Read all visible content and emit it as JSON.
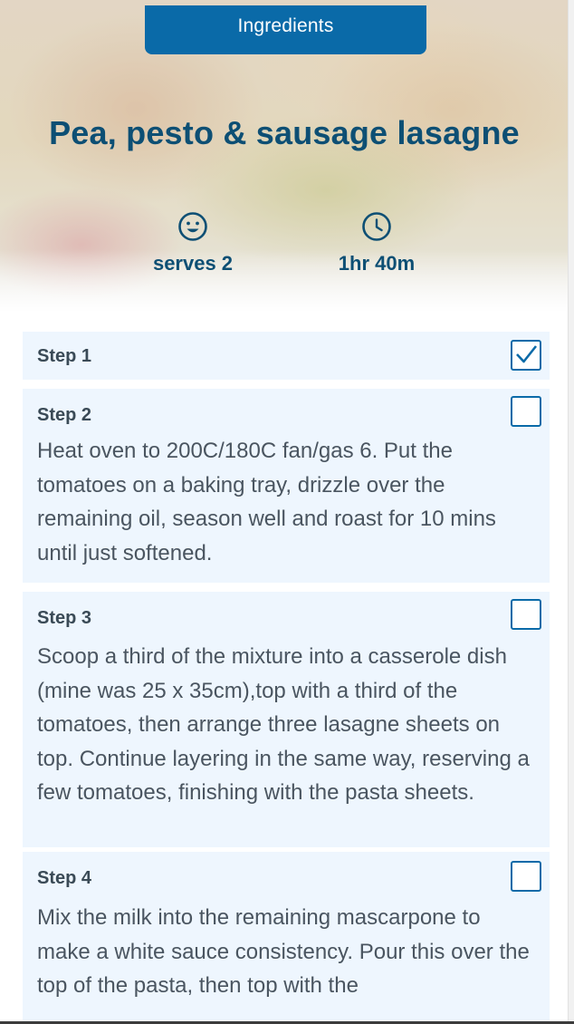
{
  "header": {
    "ingredients_tab": "Ingredients",
    "title": "Pea, pesto & sausage lasagne",
    "serves": "serves 2",
    "time": "1hr 40m"
  },
  "steps": [
    {
      "label": "Step 1",
      "text": "",
      "checked": true
    },
    {
      "label": "Step 2",
      "text": "Heat oven to 200C/180C fan/gas 6. Put the tomatoes on a baking tray, drizzle over the remaining oil, season well and roast for 10 mins until just softened.",
      "checked": false
    },
    {
      "label": "Step 3",
      "text": "Scoop a third of the mixture into a casserole dish (mine was 25 x 35cm),top with a third of the tomatoes, then arrange three lasagne sheets on top. Continue layering in the same way, reserving a few tomatoes, finishing with the pasta sheets.",
      "checked": false
    },
    {
      "label": "Step 4",
      "text": "Mix the milk into the remaining mascarpone to make a white sauce consistency. Pour this over the top of the pasta, then top with the",
      "checked": false
    }
  ],
  "colors": {
    "accent": "#0a6aa8",
    "title": "#0d4f74",
    "step_bg": "#eef6fe"
  },
  "icons": {
    "serves": "smiley-face-icon",
    "time": "clock-icon",
    "checked": "checkmark-icon"
  }
}
